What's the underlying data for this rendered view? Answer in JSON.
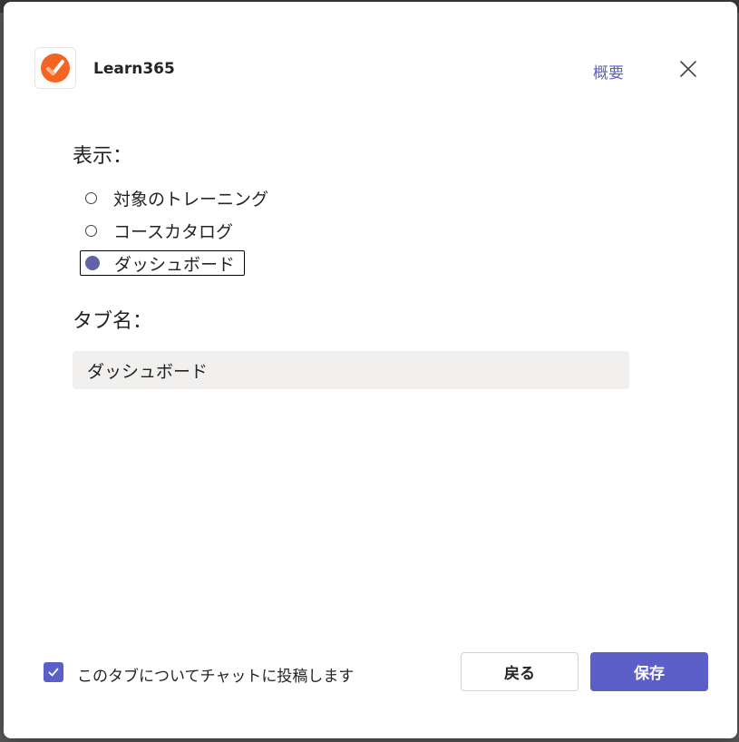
{
  "header": {
    "app_name": "Learn365",
    "about_label": "概要"
  },
  "display_section": {
    "label": "表示：",
    "options": [
      {
        "label": "対象のトレーニング",
        "selected": false
      },
      {
        "label": "コースカタログ",
        "selected": false
      },
      {
        "label": "ダッシュボード",
        "selected": true
      }
    ]
  },
  "tab_name_section": {
    "label": "タブ名：",
    "value": "ダッシュボード"
  },
  "footer": {
    "post_to_chat_label": "このタブについてチャットに投稿します",
    "post_to_chat_checked": true,
    "back_label": "戻る",
    "save_label": "保存"
  },
  "colors": {
    "accent": "#5b5fc7",
    "radio_selected": "#6264a7",
    "logo_orange": "#f26522",
    "input_bg": "#f1f0ef"
  }
}
